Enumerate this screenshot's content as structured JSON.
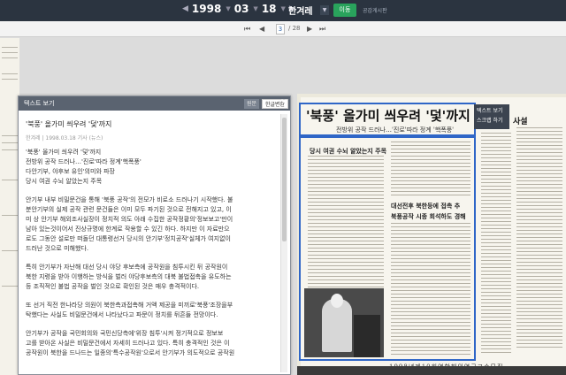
{
  "topbar": {
    "year": "1998",
    "month": "03",
    "day": "18",
    "newspaper": "한겨레",
    "go_label": "이동",
    "public_label": "공감게시판"
  },
  "pager": {
    "current": "3",
    "total": "/ 28"
  },
  "panel": {
    "title": "텍스트 보기",
    "btn_original": "원문",
    "btn_hangul": "한글변환",
    "close": "×"
  },
  "article": {
    "title": "'북풍' 올가미 씌우려 '덫'까지",
    "meta": "한겨레 | 1998.03.18 기사 (뉴스)",
    "subs": [
      "'북풍' 올가미 씌우려 '덫'까지",
      "전방위 공작 드러나…'진로'따라 정계'핵폭풍'",
      "다안기부, 야후보 유인'의미와 파장",
      "당시 여권 수뇌 알았는지 주목"
    ],
    "paragraphs": [
      [
        "안기부 내부 비밀문건을 통해 '북풍 공작'의 전모가 비로소 드러나기 시작했다. 불",
        "분안기부의 실제 공작 관련 문건들은 이미 모두 파기된 것으로 전해지고 있고, 이",
        "미 상 안기부 해외조사실장이 정치적 의도 아래 수집한 공작정황의'정보보고'만이",
        "남아 있는것이어서 진상규명에 한계로 작용할 수 있긴 하다. 하지만 이 자료만으",
        "로도 그동안 설로만 떠돌던 대통령선거 당시의 안기부'정치공작'실체가 여지없이",
        "드러난 것으로 미해했다."
      ],
      [
        "특히 안기부가 자난해 대선 당시 야당 후보측에 공작원을 침투시킨 뒤 공작원이",
        "북한 지령을 받아 이행하는 방식을 벌러 야당후보측의 대북 불법접촉을 유도하는",
        "등 조직적인 불법 공작을 벌인 것으로 확인된 것은 매우 충격적이다."
      ],
      [
        "또 선거 직전 한나라당 의원이 북한측과접촉해 거액 제공을 미끼로'북풍'조장을부",
        "탁했다는 사실도 비밀문건에서 나타났다고 파문이 정치를 뒤흔들 전망이다."
      ],
      [
        "안기부가 공작을 국민회의와 국민신당측에'위장 침투'시켜 정기적으로 정보보",
        "고를 받아온 사실은 비밀문건에서 자세히 드러나고 있다. 특히 충격적인 것은 이",
        "공작원이 북한을 드나드는 일종의'특수공작원'으로서 안기부가 의도적으로 공작원"
      ]
    ]
  },
  "newspaper": {
    "headline": "'북풍' 올가미 씌우려 '덫'까지",
    "subhead": "전방위 공작 드러나…'진로'따라 정계 '핵폭풍'",
    "tooltip_1": "텍스트 보기",
    "tooltip_2": "스크랩 하기",
    "right_head": "사설",
    "side_head_1": "당시 여권 수뇌 알았는지 주목",
    "side_head_2": "대선전후 북한등에 접촉 추",
    "side_head_3": "북풍공작 시종 회석하도 경해",
    "ad": "1998년제10회연합해외연구교수모집"
  }
}
